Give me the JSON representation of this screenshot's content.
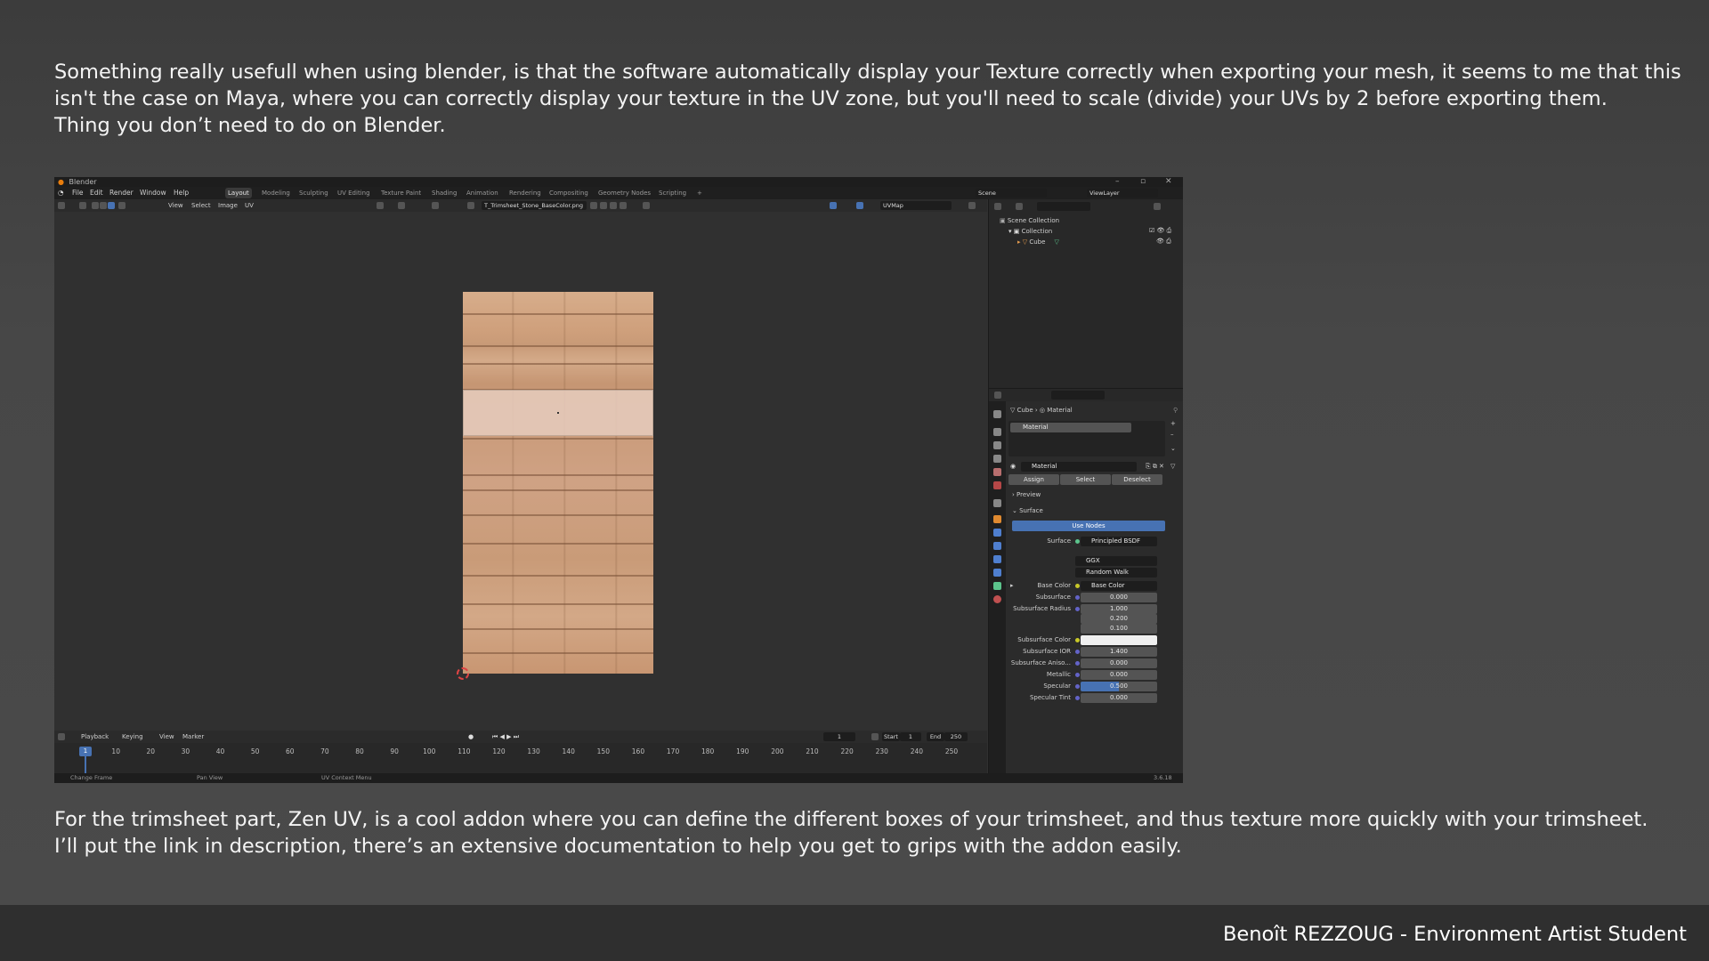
{
  "slide": {
    "paragraph_top": [
      "Something really usefull when using blender, is that the software automatically display your Texture correctly when exporting your mesh, it seems to me that this",
      "isn't the case on Maya, where you can correctly display your texture in the UV zone, but you'll need to scale (divide) your UVs by 2 before exporting them.",
      "Thing you don’t need to do on Blender."
    ],
    "paragraph_bottom": [
      "For the trimsheet part, Zen UV, is a cool addon where you can define the different boxes of your trimsheet, and thus texture more quickly with your trimsheet.",
      "I’ll put the link in description, there’s an extensive documentation to help you get to grips with the addon easily."
    ],
    "footer": "Benoît REZZOUG - Environment Artist Student"
  },
  "blender": {
    "window_title": "Blender",
    "menu": [
      "File",
      "Edit",
      "Render",
      "Window",
      "Help"
    ],
    "workspaces": [
      "Layout",
      "Modeling",
      "Sculpting",
      "UV Editing",
      "Texture Paint",
      "Shading",
      "Animation",
      "Rendering",
      "Compositing",
      "Geometry Nodes",
      "Scripting",
      "+"
    ],
    "active_workspace": "Layout",
    "scene_label": "Scene",
    "view_layer": "ViewLayer",
    "uv_header": {
      "menus": [
        "View",
        "Select",
        "Image",
        "UV"
      ],
      "image_name": "T_Trimsheet_Stone_BaseColor.png",
      "uvmap": "UVMap"
    },
    "outliner": {
      "scene_collection": "Scene Collection",
      "collection": "Collection",
      "object": "Cube"
    },
    "timeline": {
      "menus": [
        "Playback",
        "Keying",
        "View",
        "Marker"
      ],
      "current_frame": "1",
      "start_label": "Start",
      "start": "1",
      "end_label": "End",
      "end": "250",
      "ticks": [
        "1",
        "10",
        "20",
        "30",
        "40",
        "50",
        "60",
        "70",
        "80",
        "90",
        "100",
        "110",
        "120",
        "130",
        "140",
        "150",
        "160",
        "170",
        "180",
        "190",
        "200",
        "210",
        "220",
        "230",
        "240",
        "250"
      ]
    },
    "properties": {
      "breadcrumb_object": "Cube",
      "breadcrumb_material": "Material",
      "slot": "Material",
      "material_name": "Material",
      "assign": "Assign",
      "select": "Select",
      "deselect": "Deselect",
      "preview": "Preview",
      "surface_panel": "Surface",
      "use_nodes": "Use Nodes",
      "surface_label": "Surface",
      "surface_value": "Principled BSDF",
      "distribution": "GGX",
      "subsurface_method": "Random Walk",
      "base_color_label": "Base Color",
      "base_color_value": "Base Color",
      "rows": [
        {
          "label": "Subsurface",
          "value": "0.000"
        },
        {
          "label": "Subsurface Radius",
          "value": "1.000"
        },
        {
          "label": "",
          "value": "0.200"
        },
        {
          "label": "",
          "value": "0.100"
        },
        {
          "label": "Subsurface Color",
          "value": ""
        },
        {
          "label": "Subsurface IOR",
          "value": "1.400"
        },
        {
          "label": "Subsurface Aniso...",
          "value": "0.000"
        },
        {
          "label": "Metallic",
          "value": "0.000"
        },
        {
          "label": "Specular",
          "value": "0.500"
        },
        {
          "label": "Specular Tint",
          "value": "0.000"
        }
      ]
    },
    "status": {
      "change_frame": "Change Frame",
      "pan_view": "Pan View",
      "uv_context_menu": "UV Context Menu",
      "version": "3.6.18"
    }
  }
}
